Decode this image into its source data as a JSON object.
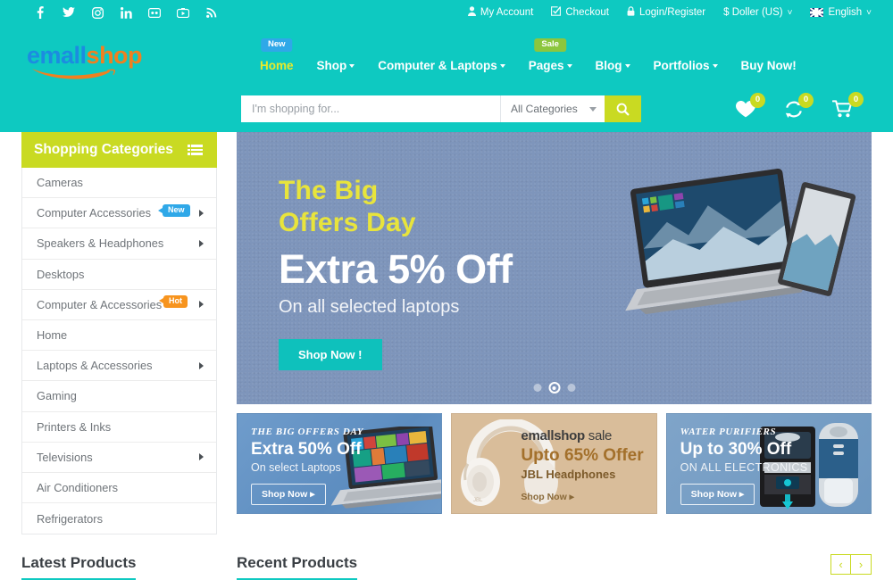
{
  "topbar": {
    "social": [
      {
        "name": "facebook-icon",
        "glyph": "f"
      },
      {
        "name": "twitter-icon",
        "glyph": "t"
      },
      {
        "name": "instagram-icon",
        "glyph": "i"
      },
      {
        "name": "linkedin-icon",
        "glyph": "in"
      },
      {
        "name": "flickr-icon",
        "glyph": "fl"
      },
      {
        "name": "youtube-icon",
        "glyph": "yt"
      },
      {
        "name": "rss-icon",
        "glyph": "rss"
      }
    ],
    "my_account": "My Account",
    "checkout": "Checkout",
    "login_register": "Login/Register",
    "currency": "$ Doller (US)",
    "language": "English"
  },
  "logo": {
    "part1": "emall",
    "part2": "shop"
  },
  "nav": [
    {
      "label": "Home",
      "active": true,
      "caret": false,
      "badge": "New",
      "badge_color": "blue"
    },
    {
      "label": "Shop",
      "active": false,
      "caret": true,
      "badge": "",
      "badge_color": ""
    },
    {
      "label": "Computer & Laptops",
      "active": false,
      "caret": true,
      "badge": "",
      "badge_color": ""
    },
    {
      "label": "Pages",
      "active": false,
      "caret": true,
      "badge": "Sale",
      "badge_color": "green"
    },
    {
      "label": "Blog",
      "active": false,
      "caret": true,
      "badge": "",
      "badge_color": ""
    },
    {
      "label": "Portfolios",
      "active": false,
      "caret": true,
      "badge": "",
      "badge_color": ""
    },
    {
      "label": "Buy Now!",
      "active": false,
      "caret": false,
      "badge": "",
      "badge_color": ""
    }
  ],
  "search": {
    "placeholder": "I'm shopping for...",
    "category": "All Categories",
    "button_icon": "search-icon"
  },
  "cart_icons": [
    {
      "name": "wishlist-heart-icon",
      "count": "0"
    },
    {
      "name": "compare-icon",
      "count": "0"
    },
    {
      "name": "shopping-cart-icon",
      "count": "0"
    }
  ],
  "sidebar": {
    "title": "Shopping Categories",
    "items": [
      {
        "label": "Cameras",
        "arrow": false,
        "badge": "",
        "badge_color": ""
      },
      {
        "label": "Computer Accessories",
        "arrow": true,
        "badge": "New",
        "badge_color": "blue"
      },
      {
        "label": "Speakers & Headphones",
        "arrow": true,
        "badge": "",
        "badge_color": ""
      },
      {
        "label": "Desktops",
        "arrow": false,
        "badge": "",
        "badge_color": ""
      },
      {
        "label": "Computer & Accessories",
        "arrow": true,
        "badge": "Hot",
        "badge_color": "orange"
      },
      {
        "label": "Home",
        "arrow": false,
        "badge": "",
        "badge_color": ""
      },
      {
        "label": "Laptops & Accessories",
        "arrow": true,
        "badge": "",
        "badge_color": ""
      },
      {
        "label": "Gaming",
        "arrow": false,
        "badge": "",
        "badge_color": ""
      },
      {
        "label": "Printers & Inks",
        "arrow": false,
        "badge": "",
        "badge_color": ""
      },
      {
        "label": "Televisions",
        "arrow": true,
        "badge": "",
        "badge_color": ""
      },
      {
        "label": "Air Conditioners",
        "arrow": false,
        "badge": "",
        "badge_color": ""
      },
      {
        "label": "Refrigerators",
        "arrow": false,
        "badge": "",
        "badge_color": ""
      }
    ]
  },
  "hero": {
    "kicker_line1": "The Big",
    "kicker_line2": "Offers Day",
    "headline": "Extra 5% Off",
    "subline": "On all selected laptops",
    "cta": "Shop Now !",
    "dots": 3,
    "active_dot": 1
  },
  "promos": [
    {
      "kicker": "THE BIG OFFERS DAY",
      "title": "Extra 50% Off",
      "sub": "On select Laptops",
      "cta": "Shop Now  ▸",
      "art": "laptop-windows8"
    },
    {
      "brand": "emallshop",
      "brand_suffix": "sale",
      "title": "Upto 65% Offer",
      "sub": "JBL Headphones",
      "cta": "Shop Now  ▸",
      "art": "white-headphones"
    },
    {
      "kicker": "WATER PURIFIERS",
      "title": "Up to 30% Off",
      "sub": "ON ALL ELECTRONICS",
      "cta": "Shop Now  ▸",
      "art": "water-purifiers"
    }
  ],
  "sections": {
    "latest": "Latest Products",
    "recent": "Recent Products",
    "prev": "‹",
    "next": "›"
  },
  "colors": {
    "teal": "#0ec9c1",
    "lime": "#c9da22",
    "yellow": "#e8e43c",
    "orange": "#f08020",
    "blue": "#1c8ce0",
    "badge_blue": "#2fa8e8",
    "badge_green": "#8cc63e",
    "badge_orange": "#f7941e",
    "hero_bg": "#7e95bb"
  }
}
